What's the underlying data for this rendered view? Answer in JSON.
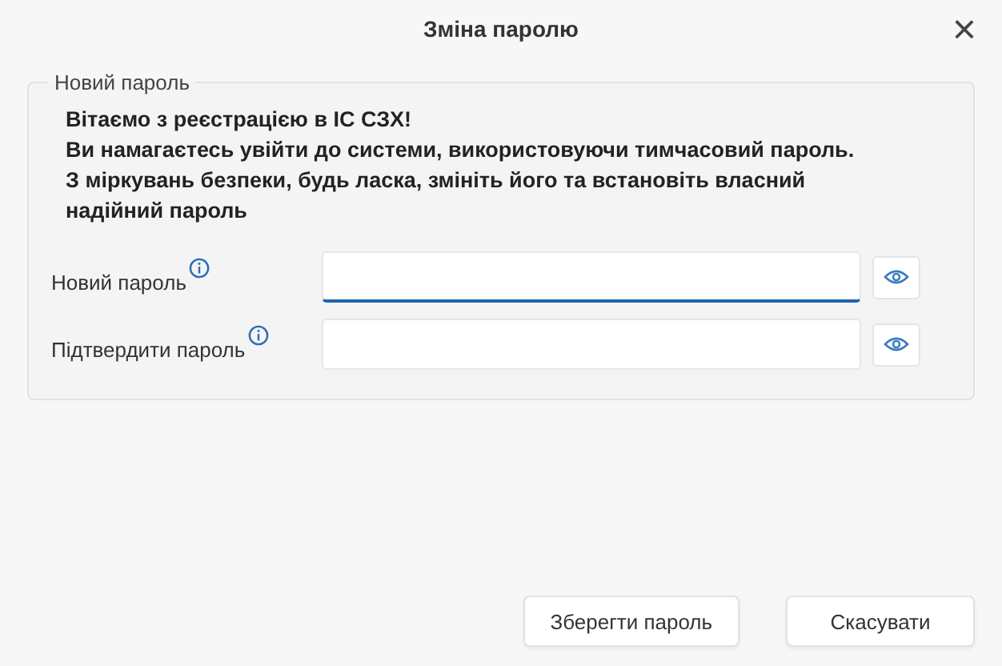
{
  "window": {
    "title": "Зміна паролю",
    "close": "×"
  },
  "group": {
    "legend": "Новий пароль",
    "message": [
      "Вітаємо з реєстрацією в ІС СЗХ!",
      "Ви намагаєтесь увійти до системи, використовуючи тимчасовий пароль.",
      "З міркувань безпеки, будь ласка, змініть його та встановіть власний",
      "надійний пароль"
    ],
    "fields": [
      {
        "label": "Новий пароль",
        "focused": true
      },
      {
        "label": "Підтвердити пароль",
        "focused": false
      }
    ]
  },
  "buttons": [
    "Зберегти пароль",
    "Скасувати"
  ]
}
